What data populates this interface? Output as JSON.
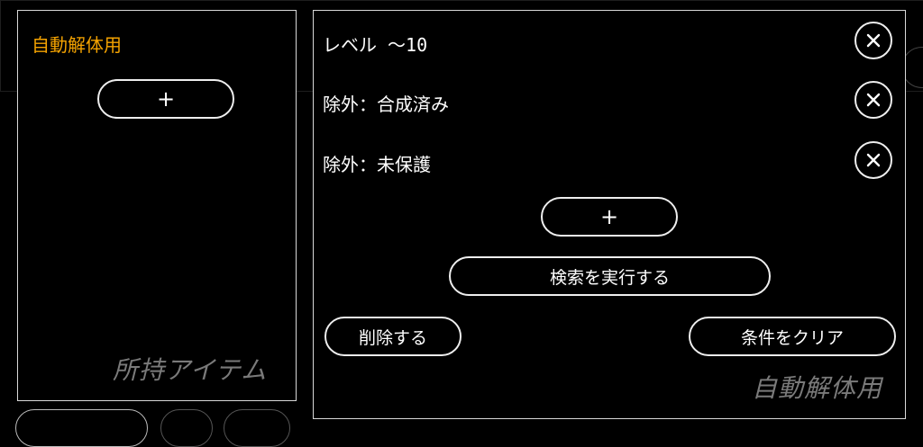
{
  "left_panel": {
    "title": "自動解体用",
    "add_label": "+",
    "watermark": "所持アイテム"
  },
  "right_panel": {
    "conditions": [
      {
        "label": "レベル ～10",
        "remove_icon": "close-circle-icon"
      },
      {
        "label": "除外：合成済み",
        "remove_icon": "close-circle-icon"
      },
      {
        "label": "除外：未保護",
        "remove_icon": "close-circle-icon"
      }
    ],
    "add_label": "+",
    "search_label": "検索を実行する",
    "delete_label": "削除する",
    "clear_label": "条件をクリア",
    "watermark": "自動解体用"
  },
  "colors": {
    "accent": "#f5a300",
    "border": "#d8d8d8",
    "watermark": "#7a7a7a"
  }
}
